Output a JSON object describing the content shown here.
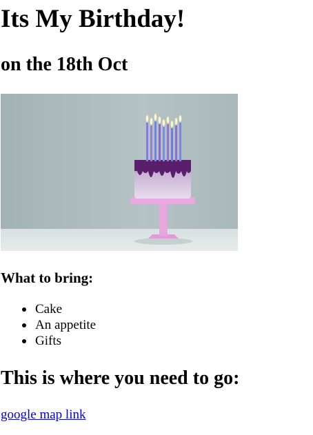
{
  "page": {
    "heading": "Its My Birthday!",
    "subheading": "on the 18th Oct",
    "bring_heading": "What to bring:",
    "bring_items": [
      "Cake",
      "An appetite",
      "Gifts"
    ],
    "directions_heading": "This is where you need to go:",
    "map_link_text": "google map link"
  },
  "image": {
    "subject": "birthday-cake-with-candles-photo"
  },
  "colors": {
    "link": "#0000ee",
    "text": "#000000",
    "background": "#ffffff"
  }
}
